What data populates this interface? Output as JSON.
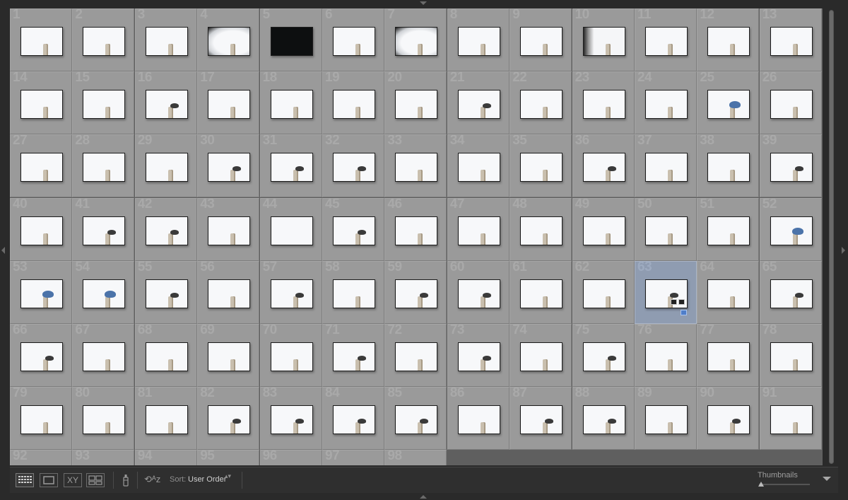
{
  "grid": {
    "selected": 63,
    "cells": [
      {
        "num": "1",
        "t": "post"
      },
      {
        "num": "2",
        "t": "post"
      },
      {
        "num": "3",
        "t": "post"
      },
      {
        "num": "4",
        "t": "vigpost"
      },
      {
        "num": "5",
        "t": "dark"
      },
      {
        "num": "6",
        "t": "post"
      },
      {
        "num": "7",
        "t": "vigpost"
      },
      {
        "num": "8",
        "t": "post"
      },
      {
        "num": "9",
        "t": "post"
      },
      {
        "num": "10",
        "t": "vigleft"
      },
      {
        "num": "11",
        "t": "post"
      },
      {
        "num": "12",
        "t": "post"
      },
      {
        "num": "13",
        "t": "post"
      },
      {
        "num": "14",
        "t": "post"
      },
      {
        "num": "15",
        "t": "post"
      },
      {
        "num": "16",
        "t": "bird"
      },
      {
        "num": "17",
        "t": "post"
      },
      {
        "num": "18",
        "t": "post"
      },
      {
        "num": "19",
        "t": "post"
      },
      {
        "num": "20",
        "t": "post"
      },
      {
        "num": "21",
        "t": "bird"
      },
      {
        "num": "22",
        "t": "post"
      },
      {
        "num": "23",
        "t": "post"
      },
      {
        "num": "24",
        "t": "post"
      },
      {
        "num": "25",
        "t": "blue"
      },
      {
        "num": "26",
        "t": "post"
      },
      {
        "num": "27",
        "t": "post"
      },
      {
        "num": "28",
        "t": "post"
      },
      {
        "num": "29",
        "t": "post"
      },
      {
        "num": "30",
        "t": "bird"
      },
      {
        "num": "31",
        "t": "bird"
      },
      {
        "num": "32",
        "t": "bird"
      },
      {
        "num": "33",
        "t": "post"
      },
      {
        "num": "34",
        "t": "post"
      },
      {
        "num": "35",
        "t": "post"
      },
      {
        "num": "36",
        "t": "bird"
      },
      {
        "num": "37",
        "t": "post"
      },
      {
        "num": "38",
        "t": "post"
      },
      {
        "num": "39",
        "t": "bird"
      },
      {
        "num": "40",
        "t": "post"
      },
      {
        "num": "41",
        "t": "bird"
      },
      {
        "num": "42",
        "t": "bird"
      },
      {
        "num": "43",
        "t": "post"
      },
      {
        "num": "44",
        "t": "plain"
      },
      {
        "num": "45",
        "t": "bird"
      },
      {
        "num": "46",
        "t": "post"
      },
      {
        "num": "47",
        "t": "post"
      },
      {
        "num": "48",
        "t": "post"
      },
      {
        "num": "49",
        "t": "post"
      },
      {
        "num": "50",
        "t": "post"
      },
      {
        "num": "51",
        "t": "post"
      },
      {
        "num": "52",
        "t": "blue"
      },
      {
        "num": "53",
        "t": "blue"
      },
      {
        "num": "54",
        "t": "blue"
      },
      {
        "num": "55",
        "t": "bird"
      },
      {
        "num": "56",
        "t": "post"
      },
      {
        "num": "57",
        "t": "bird"
      },
      {
        "num": "58",
        "t": "post"
      },
      {
        "num": "59",
        "t": "bird"
      },
      {
        "num": "60",
        "t": "bird"
      },
      {
        "num": "61",
        "t": "post"
      },
      {
        "num": "62",
        "t": "post"
      },
      {
        "num": "63",
        "t": "bird"
      },
      {
        "num": "64",
        "t": "post"
      },
      {
        "num": "65",
        "t": "bird"
      },
      {
        "num": "66",
        "t": "bird"
      },
      {
        "num": "67",
        "t": "post"
      },
      {
        "num": "68",
        "t": "post"
      },
      {
        "num": "69",
        "t": "post"
      },
      {
        "num": "70",
        "t": "post"
      },
      {
        "num": "71",
        "t": "bird"
      },
      {
        "num": "72",
        "t": "post"
      },
      {
        "num": "73",
        "t": "bird"
      },
      {
        "num": "74",
        "t": "post"
      },
      {
        "num": "75",
        "t": "bird"
      },
      {
        "num": "76",
        "t": "post"
      },
      {
        "num": "77",
        "t": "post"
      },
      {
        "num": "78",
        "t": "post"
      },
      {
        "num": "79",
        "t": "post"
      },
      {
        "num": "80",
        "t": "post"
      },
      {
        "num": "81",
        "t": "post"
      },
      {
        "num": "82",
        "t": "bird"
      },
      {
        "num": "83",
        "t": "bird"
      },
      {
        "num": "84",
        "t": "bird"
      },
      {
        "num": "85",
        "t": "bird"
      },
      {
        "num": "86",
        "t": "post"
      },
      {
        "num": "87",
        "t": "bird"
      },
      {
        "num": "88",
        "t": "bird"
      },
      {
        "num": "89",
        "t": "post"
      },
      {
        "num": "90",
        "t": "bird"
      },
      {
        "num": "91",
        "t": "post"
      },
      {
        "num": "92",
        "t": "post"
      },
      {
        "num": "93",
        "t": "post"
      },
      {
        "num": "94",
        "t": "post"
      },
      {
        "num": "95",
        "t": "post"
      },
      {
        "num": "96",
        "t": "post"
      },
      {
        "num": "97",
        "t": "post"
      },
      {
        "num": "98",
        "t": "post"
      }
    ]
  },
  "toolbar": {
    "compare_label": "XY",
    "sort_icon": "sort-az-icon",
    "sort_glyph": "⟲ᴬᴢ",
    "sort_label": "Sort:",
    "sort_value": "User Order",
    "sort_caret": "▴▾",
    "thumbnails_label": "Thumbnails",
    "thumbnail_size": 0
  },
  "colors": {
    "selected_cell": "#8f9cb1",
    "cell": "#9a9a9a",
    "flag": "#4f7ec9"
  }
}
